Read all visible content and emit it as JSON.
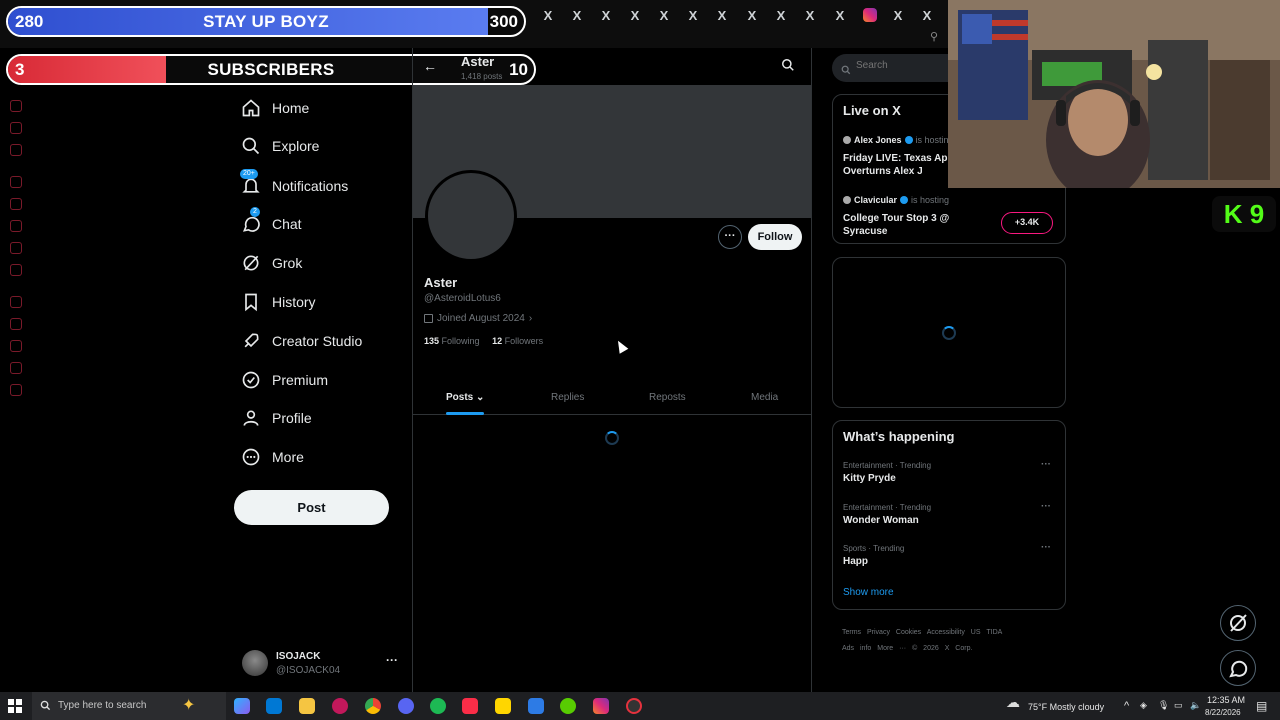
{
  "overlay": {
    "goal1": {
      "left": "280",
      "title": "STAY UP BOYZ",
      "right": "300",
      "progress": 0.93
    },
    "goal2": {
      "left": "3",
      "title": "SUBSCRIBERS",
      "right": "10",
      "progress": 0.3
    }
  },
  "nav": {
    "items": [
      {
        "label": "Home",
        "icon": "home-icon"
      },
      {
        "label": "Explore",
        "icon": "search-icon"
      },
      {
        "label": "Notifications",
        "icon": "bell-icon",
        "badge": "20+"
      },
      {
        "label": "Chat",
        "icon": "chat-icon",
        "badge": "2"
      },
      {
        "label": "Grok",
        "icon": "grok-icon"
      },
      {
        "label": "History",
        "icon": "bookmark-icon"
      },
      {
        "label": "Creator Studio",
        "icon": "rocket-icon"
      },
      {
        "label": "Premium",
        "icon": "verified-icon"
      },
      {
        "label": "Profile",
        "icon": "person-icon"
      },
      {
        "label": "More",
        "icon": "more-circle-icon"
      }
    ],
    "post_label": "Post"
  },
  "account": {
    "name": "ISOJACK",
    "handle": "@ISOJACK04",
    "more": "···"
  },
  "profile": {
    "header_name": "Aster",
    "header_posts": "1,418 posts",
    "display_name": "Aster",
    "handle": "@AsteroidLotus6",
    "joined": "Joined August 2024",
    "following_count": "135",
    "following_label": "Following",
    "followers_count": "12",
    "followers_label": "Followers",
    "follow_label": "Follow",
    "more_label": "···"
  },
  "tabs": [
    {
      "label": "Posts",
      "active": true
    },
    {
      "label": "Replies",
      "active": false
    },
    {
      "label": "Reposts",
      "active": false
    },
    {
      "label": "Media",
      "active": false
    }
  ],
  "search": {
    "placeholder": "Search"
  },
  "live": {
    "title": "Live on X",
    "spaces": [
      {
        "host": "Alex Jones",
        "hosting": "is hosting",
        "title": "Friday LIVE: Texas App Court Overturns Alex J"
      },
      {
        "host": "Clavicular",
        "hosting": "is hosting",
        "title": "College Tour Stop 3 @ Syracuse",
        "listeners": "+3.4K"
      }
    ]
  },
  "trends": {
    "title": "What’s happening",
    "items": [
      {
        "meta": "Entertainment · Trending",
        "name": "Kitty Pryde"
      },
      {
        "meta": "Entertainment · Trending",
        "name": "Wonder Woman"
      },
      {
        "meta": "Sports · Trending",
        "name": "Happ"
      }
    ],
    "show_more": "Show more"
  },
  "footer": {
    "line1": "Terms   Privacy   Cookies   Accessibility   US TIDA",
    "line2": "Ads info   More ···   © 2026 X Corp."
  },
  "kick_badge": "K 9",
  "taskbar": {
    "search_placeholder": "Type here to search",
    "weather": "75°F  Mostly cloudy",
    "time": "12:35 AM",
    "date": "8/22/2026"
  },
  "colors": {
    "accent": "#1d9bf0",
    "goal_red": "#e5323e",
    "goal_blue": "#3a5bd9",
    "kick_green": "#53fc18"
  }
}
